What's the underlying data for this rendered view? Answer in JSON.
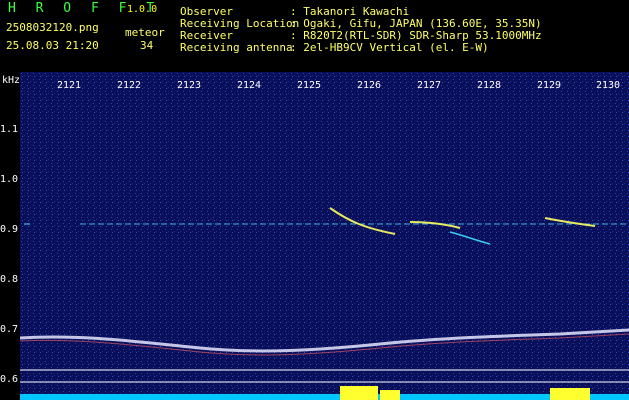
{
  "header": {
    "brand": "H R O F F T",
    "version": "1.0.0",
    "filename": "2508032120.png",
    "meteor_label": "meteor",
    "datetime": "25.08.03 21:20",
    "meteor_count": "34",
    "info": [
      {
        "key": "Observer",
        "value": ": Takanori Kawachi"
      },
      {
        "key": "Receiving Location",
        "value": ": Ogaki, Gifu, JAPAN (136.60E, 35.35N)"
      },
      {
        "key": "Receiver",
        "value": ": R820T2(RTL-SDR) SDR-Sharp 53.1000MHz"
      },
      {
        "key": "Receiving antenna",
        "value": ": 2el-HB9CV Vertical (el. E-W)"
      }
    ]
  },
  "spectrogram": {
    "y_unit": "kHz",
    "y_ticks": [
      "1.1",
      "1.0",
      "0.9",
      "0.8",
      "0.7",
      "0.6"
    ],
    "x_ticks": [
      "2121",
      "2122",
      "2123",
      "2124",
      "2125",
      "2126",
      "2127",
      "2128",
      "2129",
      "2130"
    ],
    "colors": {
      "background": "#0a0f5a",
      "noise": "#2a3fb0",
      "trace": "#e6e6ff",
      "meteor": "#ffff40",
      "signal": "#40e0ff"
    }
  }
}
